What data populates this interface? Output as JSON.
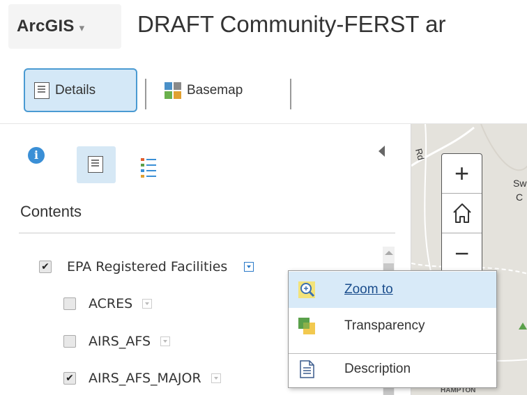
{
  "header": {
    "brand": "ArcGIS",
    "brand_caret": "▾",
    "title": "DRAFT Community-FERST ar"
  },
  "toolbar": {
    "details_label": "Details",
    "basemap_label": "Basemap"
  },
  "panel": {
    "contents_title": "Contents",
    "layers": [
      {
        "name": "EPA Registered Facilities",
        "checked": true
      },
      {
        "name": "ACRES",
        "checked": false
      },
      {
        "name": "AIRS_AFS",
        "checked": false
      },
      {
        "name": "AIRS_AFS_MAJOR",
        "checked": true
      }
    ]
  },
  "map": {
    "labels": [
      "Rd",
      "Sw",
      "C",
      "HAMPTON"
    ],
    "zoom_in": "+",
    "zoom_out": "−"
  },
  "menu": {
    "items": [
      {
        "label": "Zoom to",
        "icon": "zoom-to-icon"
      },
      {
        "label": "Transparency",
        "icon": "transparency-icon"
      },
      {
        "label": "Description",
        "icon": "description-icon"
      }
    ]
  },
  "colors": {
    "accent": "#4a9ad2",
    "selected_bg": "#d4e8f7",
    "menu_hover": "#d8eaf8",
    "info": "#3a8fd6"
  }
}
